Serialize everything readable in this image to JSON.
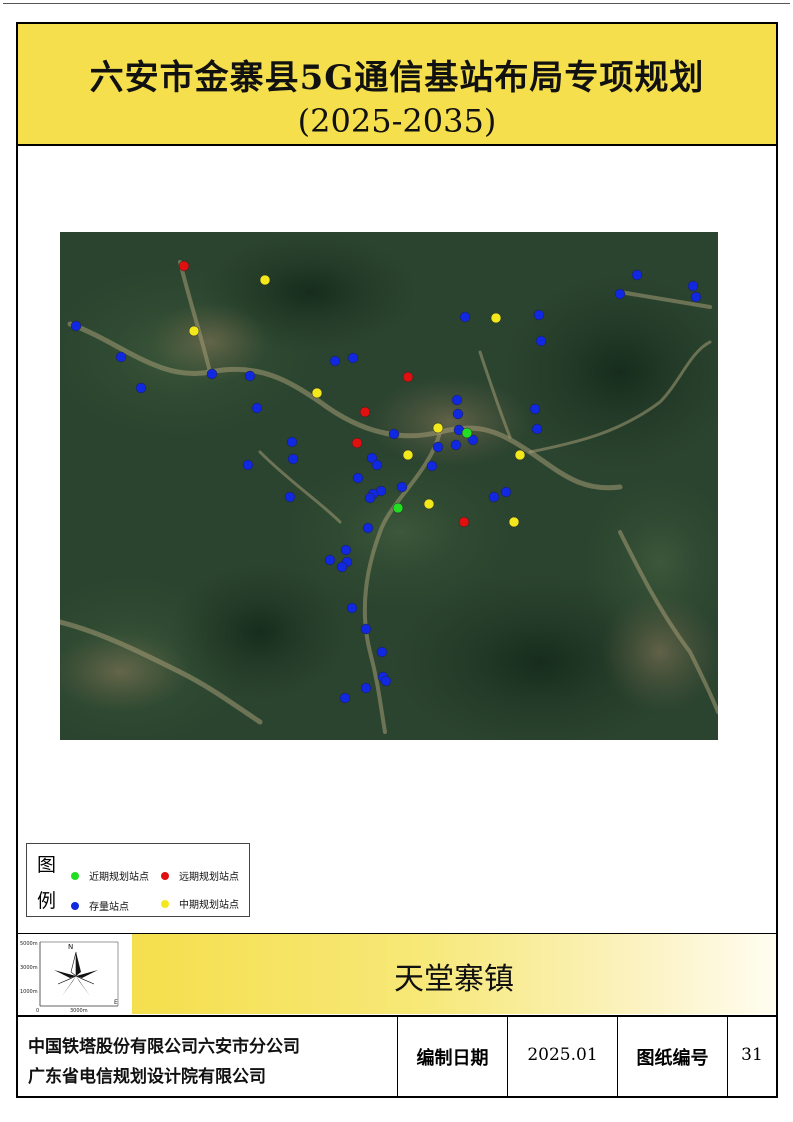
{
  "title": {
    "line1": "六安市金寨县5G通信基站布局专项规划",
    "line2": "(2025-2035)"
  },
  "map": {
    "legend": {
      "title_top": "图",
      "title_bottom": "例",
      "items": [
        {
          "label": "近期规划站点",
          "color": "#22dd22"
        },
        {
          "label": "远期规划站点",
          "color": "#e01010"
        },
        {
          "label": "存量站点",
          "color": "#1028e0"
        },
        {
          "label": "中期规划站点",
          "color": "#f2e81c"
        }
      ]
    },
    "compass": {
      "north_label": "N",
      "scale_labels": [
        "5000m",
        "3000m",
        "1000m",
        "0",
        "3000m",
        "E"
      ]
    },
    "sites": {
      "existing": 46,
      "near_term": 2,
      "long_term": 6,
      "mid_term": 10
    }
  },
  "town": "天堂寨镇",
  "footer": {
    "org_line1": "中国铁塔股份有限公司六安市分公司",
    "org_line2": "广东省电信规划设计院有限公司",
    "date_label": "编制日期",
    "date_value": "2025.01",
    "drawing_no_label": "图纸编号",
    "drawing_no_value": "31"
  }
}
